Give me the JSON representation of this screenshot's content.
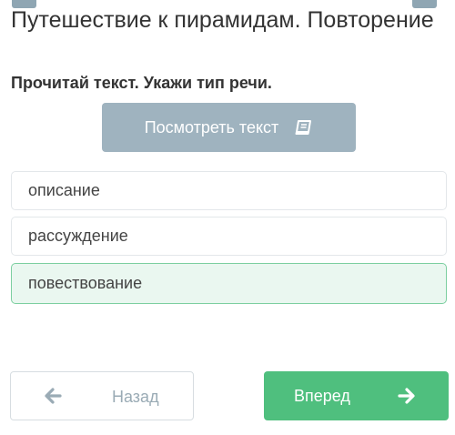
{
  "header": {
    "title": "Путешествие к пирамидам. Повторение"
  },
  "task": {
    "instruction": "Прочитай текст. Укажи тип речи.",
    "view_text_label": "Посмотреть текст"
  },
  "options": [
    {
      "label": "описание",
      "selected": false
    },
    {
      "label": "рассуждение",
      "selected": false
    },
    {
      "label": "повествование",
      "selected": true
    }
  ],
  "navigation": {
    "back_label": "Назад",
    "next_label": "Вперед"
  },
  "icons": {
    "view_text": "book-icon",
    "back": "arrow-left-icon",
    "next": "arrow-right-icon"
  },
  "colors": {
    "primary_disabled": "#9fb3bf",
    "success": "#4fbf7e",
    "selected_background": "#eaf7f0",
    "selected_border": "#7ccfa0"
  }
}
